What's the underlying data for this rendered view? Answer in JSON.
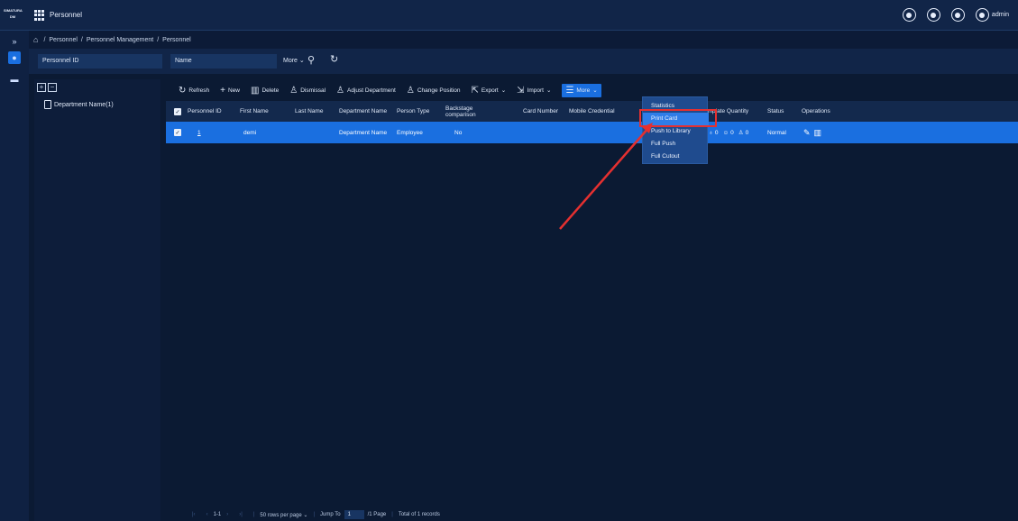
{
  "app": {
    "logo_text": "SIMATURA DM",
    "title": "Personnel",
    "user": "admin"
  },
  "breadcrumb": {
    "items": [
      "Personnel",
      "Personnel Management",
      "Personnel"
    ],
    "separator": "/"
  },
  "search": {
    "personnel_id_placeholder": "Personnel ID",
    "name_placeholder": "Name",
    "more_label": "More"
  },
  "tree": {
    "node_label": "Department Name(1)"
  },
  "toolbar": {
    "refresh": "Refresh",
    "new": "New",
    "delete": "Delete",
    "dismissal": "Dismissal",
    "adjust_department": "Adjust Department",
    "change_position": "Change Position",
    "export": "Export",
    "import": "Import",
    "more": "More"
  },
  "table": {
    "headers": {
      "personnel_id": "Personnel ID",
      "first_name": "First Name",
      "last_name": "Last Name",
      "department_name": "Department Name",
      "person_type": "Person Type",
      "backstage_comparison": "Backstage comparison",
      "card_number": "Card Number",
      "mobile_credential": "Mobile Credential",
      "template_quantity": "emplate Quantity",
      "status": "Status",
      "operations": "Operations"
    },
    "rows": [
      {
        "personnel_id": "1",
        "first_name": "demi",
        "last_name": "",
        "department_name": "Department Name",
        "person_type": "Employee",
        "backstage_comparison": "No",
        "template_fp": "0",
        "template_face": "0",
        "template_palm": "0",
        "status": "Normal"
      }
    ]
  },
  "more_menu": {
    "items": [
      "Statistics",
      "Print Card",
      "Push to Library",
      "Full Push",
      "Full Cutout"
    ],
    "selected": "Print Card"
  },
  "footer": {
    "range": "1-1",
    "page_size": "50 rows per page",
    "jump_to": "Jump To",
    "jump_value": "1",
    "page_count": "/1 Page",
    "total": "Total of 1 records"
  },
  "colors": {
    "accent": "#1a6fe0",
    "background": "#0b1a33",
    "annotation": "#e53030"
  }
}
